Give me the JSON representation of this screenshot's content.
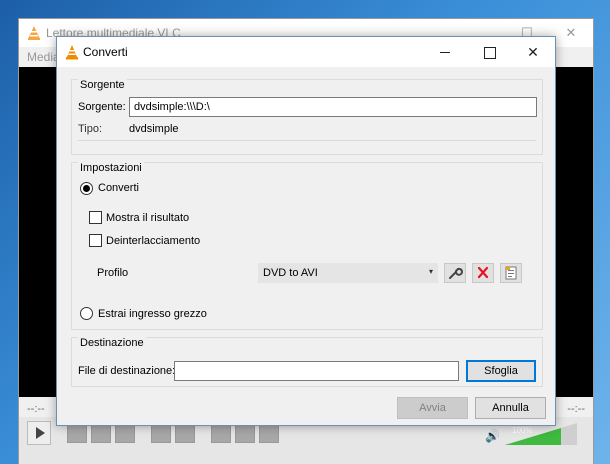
{
  "background_window": {
    "title": "Lettore multimediale VLC",
    "menu_partial": "Media",
    "time_left": "--:--",
    "time_right": "--:--",
    "volume_label": "100%"
  },
  "dialog": {
    "title": "Converti",
    "source_group": {
      "title": "Sorgente",
      "source_label": "Sorgente:",
      "source_value": "dvdsimple:\\\\\\D:\\",
      "type_label": "Tipo:",
      "type_value": "dvdsimple"
    },
    "settings_group": {
      "title": "Impostazioni",
      "convert_option": "Converti",
      "show_result": "Mostra il risultato",
      "deinterlace": "Deinterlacciamento",
      "profile_label": "Profilo",
      "profile_value": "DVD to AVI",
      "raw_option": "Estrai ingresso grezzo"
    },
    "destination_group": {
      "title": "Destinazione",
      "file_label": "File di destinazione:",
      "file_value": "",
      "browse_button": "Sfoglia"
    },
    "buttons": {
      "start": "Avvia",
      "cancel": "Annulla"
    }
  },
  "colors": {
    "accent": "#0078d7",
    "delete_red": "#e81123",
    "vlc_orange": "#f08c00"
  }
}
